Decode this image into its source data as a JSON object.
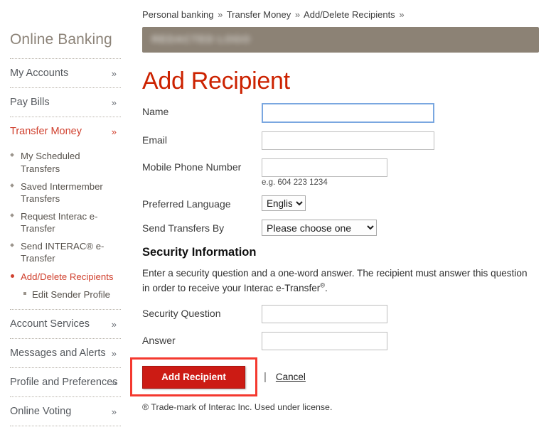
{
  "sidebar": {
    "brand": "Online Banking",
    "items": [
      {
        "label": "My Accounts",
        "chevron": "»",
        "active": false
      },
      {
        "label": "Pay Bills",
        "chevron": "»",
        "active": false
      },
      {
        "label": "Transfer Money",
        "chevron": "»",
        "active": true
      }
    ],
    "sub_items": [
      {
        "label": "My Scheduled Transfers",
        "active": false,
        "nested": false
      },
      {
        "label": "Saved Intermember Transfers",
        "active": false,
        "nested": false
      },
      {
        "label": "Request Interac e-Transfer",
        "active": false,
        "nested": false
      },
      {
        "label": "Send INTERAC® e-Transfer",
        "active": false,
        "nested": false
      },
      {
        "label": "Add/Delete Recipients",
        "active": true,
        "nested": false
      },
      {
        "label": "Edit Sender Profile",
        "active": false,
        "nested": true
      }
    ],
    "items_bottom": [
      {
        "label": "Account Services",
        "chevron": "»",
        "active": false
      },
      {
        "label": "Messages and Alerts",
        "chevron": "»",
        "active": false
      },
      {
        "label": "Profile and Preferences",
        "chevron": "»",
        "active": false
      },
      {
        "label": "Online Voting",
        "chevron": "»",
        "active": false
      }
    ]
  },
  "breadcrumb": {
    "crumb1": "Personal banking",
    "sep1": "»",
    "crumb2": "Transfer Money",
    "sep2": "»",
    "crumb3": "Add/Delete Recipients",
    "sep3": "»"
  },
  "header_bar": {
    "logo_text": "REDACTED LOGO",
    "background_color": "#8c8275"
  },
  "main": {
    "title": "Add Recipient",
    "title_color": "#cc2200",
    "fields": {
      "name_label": "Name",
      "name_value": "",
      "email_label": "Email",
      "email_value": "",
      "mobile_label": "Mobile Phone Number",
      "mobile_value": "",
      "mobile_hint": "e.g. 604 223 1234",
      "language_label": "Preferred Language",
      "language_value": "English",
      "language_options": [
        "English"
      ],
      "send_by_label": "Send Transfers By",
      "send_by_value": "Please choose one",
      "send_by_options": [
        "Please choose one"
      ]
    },
    "security": {
      "title": "Security Information",
      "description": "Enter a security question and a one-word answer. The recipient must answer this question in order to receive your Interac e-Transfer",
      "description_sup": "®",
      "description_end": ".",
      "question_label": "Security Question",
      "question_value": "",
      "answer_label": "Answer",
      "answer_value": ""
    },
    "actions": {
      "submit_label": "Add Recipient",
      "separator": "|",
      "cancel_label": "Cancel",
      "submit_color": "#cc1b14"
    },
    "footnote": "® Trade-mark of Interac Inc. Used under license.",
    "highlight_color": "#f4392f"
  }
}
